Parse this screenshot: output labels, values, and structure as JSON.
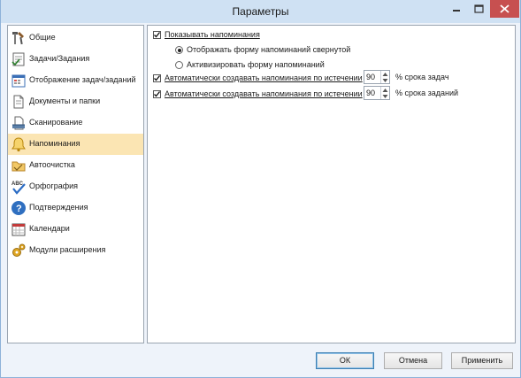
{
  "window": {
    "title": "Параметры"
  },
  "titlebar_buttons": {
    "minimize": "minimize-icon",
    "maximize": "maximize-icon",
    "close": "close-icon"
  },
  "sidebar": {
    "items": [
      {
        "label": "Общие",
        "icon": "tools-icon",
        "active": false
      },
      {
        "label": "Задачи/Задания",
        "icon": "task-icon",
        "active": false
      },
      {
        "label": "Отображение задач/заданий",
        "icon": "calendar-view-icon",
        "active": false
      },
      {
        "label": "Документы и папки",
        "icon": "document-icon",
        "active": false
      },
      {
        "label": "Сканирование",
        "icon": "scanner-icon",
        "active": false
      },
      {
        "label": "Напоминания",
        "icon": "bell-icon",
        "active": true
      },
      {
        "label": "Автоочистка",
        "icon": "folder-clean-icon",
        "active": false
      },
      {
        "label": "Орфография",
        "icon": "spellcheck-icon",
        "active": false
      },
      {
        "label": "Подтверждения",
        "icon": "question-icon",
        "active": false
      },
      {
        "label": "Календари",
        "icon": "calendar-icon",
        "active": false
      },
      {
        "label": "Модули расширения",
        "icon": "gears-icon",
        "active": false
      }
    ]
  },
  "content": {
    "show_reminders": {
      "label": "Показывать напоминания",
      "checked": true
    },
    "radio_collapsed": {
      "label": "Отображать форму напоминаний свернутой",
      "selected": true
    },
    "radio_activate": {
      "label": "Активизировать форму напоминаний",
      "selected": false
    },
    "auto_tasks": {
      "label": "Автоматически создавать напоминания по истечении",
      "checked": true,
      "value": "90",
      "suffix": "% срока задач"
    },
    "auto_assignments": {
      "label": "Автоматически создавать напоминания по истечении",
      "checked": true,
      "value": "90",
      "suffix": "% срока заданий"
    }
  },
  "buttons": {
    "ok": "ОК",
    "cancel": "Отмена",
    "apply": "Применить"
  },
  "colors": {
    "active_item": "#fbe5b3",
    "close_button": "#c75050",
    "titlebar": "#cfe1f3"
  }
}
